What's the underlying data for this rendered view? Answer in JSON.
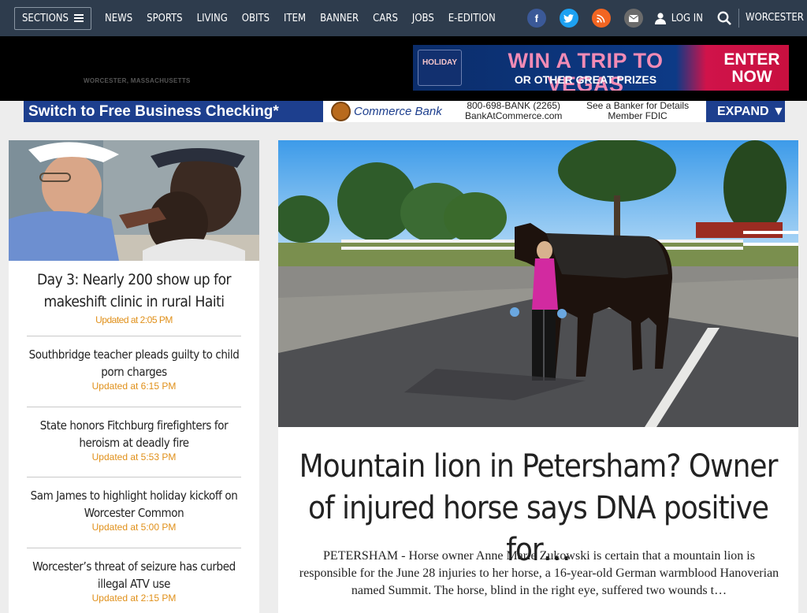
{
  "nav": {
    "sections_label": "SECTIONS",
    "links": [
      "NEWS",
      "SPORTS",
      "LIVING",
      "OBITS",
      "ITEM",
      "BANNER",
      "CARS",
      "JOBS",
      "E-EDITION"
    ],
    "login_label": "LOG IN",
    "city_label": "WORCESTER"
  },
  "social": {
    "facebook_color": "#3b5998",
    "twitter_color": "#1da1f2",
    "rss_color": "#f26522",
    "email_color": "#6b6b6b"
  },
  "masthead": {
    "dateline": "WORCESTER, MASSACHUSETTS"
  },
  "ads": {
    "vegas": {
      "logo_text": "HOLIDAY",
      "headline": "WIN A TRIP TO VEGAS",
      "subline": "OR OTHER GREAT PRIZES",
      "cta_line1": "ENTER",
      "cta_line2": "NOW"
    },
    "bank": {
      "headline": "Switch to Free Business Checking*",
      "brand": "Commerce Bank",
      "phone": "800-698-BANK (2265)",
      "url": "BankAtCommerce.com",
      "info1": "See a Banker for Details",
      "info2": "Member FDIC",
      "expand": "EXPAND ▼"
    }
  },
  "sidebar": {
    "lead": {
      "title": "Day 3: Nearly 200 show up for makeshift clinic in rural Haiti",
      "updated": "Updated at 2:05 PM"
    },
    "stories": [
      {
        "title": "Southbridge teacher pleads guilty to child porn charges",
        "updated": "Updated at 6:15 PM"
      },
      {
        "title": "State honors Fitchburg firefighters for heroism at deadly fire",
        "updated": "Updated at 5:53 PM"
      },
      {
        "title": "Sam James to highlight holiday kickoff on Worcester Common",
        "updated": "Updated at 5:00 PM"
      },
      {
        "title": "Worcester’s threat of seizure has curbed illegal ATV use",
        "updated": "Updated at 2:15 PM"
      }
    ]
  },
  "main": {
    "title": "Mountain lion in Petersham? Owner of injured horse says DNA positive for…",
    "body": "PETERSHAM - Horse owner Anne Marie Zukowski is certain that a mountain lion is responsible for the June 28 injuries to her horse, a 16-year-old German warmblood Hanoverian named Summit. The horse, blind in the right eye, suffered two wounds t…"
  }
}
